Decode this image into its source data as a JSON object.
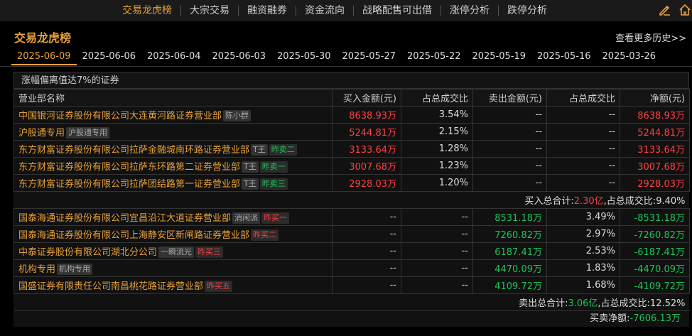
{
  "nav": {
    "items": [
      "交易龙虎榜",
      "大宗交易",
      "融资融券",
      "资金流向",
      "战略配售可出借",
      "涨停分析",
      "跌停分析"
    ],
    "active": 0
  },
  "icons": [
    "edit-icon",
    "home-icon"
  ],
  "header": {
    "title": "交易龙虎榜",
    "more": "查看更多历史>>"
  },
  "dates": [
    "2025-06-09",
    "2025-06-06",
    "2025-06-04",
    "2025-06-03",
    "2025-05-30",
    "2025-05-27",
    "2025-05-22",
    "2025-05-19",
    "2025-05-16",
    "2025-03-26"
  ],
  "active_date": 0,
  "section": {
    "caption": "涨幅偏离值达7%的证券"
  },
  "columns": [
    "营业部名称",
    "买入金额(元)",
    "占总成交比",
    "卖出金额(元)",
    "占总成交比",
    "净额(元)"
  ],
  "buy_rows": [
    {
      "name": "中国银河证券股份有限公司大连黄河路证券营业部",
      "tag": "陈小群",
      "tag2": "",
      "buy": "8638.93万",
      "buy_pct": "3.54%",
      "sell": "--",
      "sell_pct": "--",
      "net": "8638.93万"
    },
    {
      "name": "沪股通专用",
      "tag": "沪股通专用",
      "tag2": "",
      "buy": "5244.81万",
      "buy_pct": "2.15%",
      "sell": "--",
      "sell_pct": "--",
      "net": "5244.81万"
    },
    {
      "name": "东方财富证券股份有限公司拉萨金融城南环路证券营业部",
      "tag": "T王",
      "tag2": "昨卖二",
      "buy": "3133.64万",
      "buy_pct": "1.28%",
      "sell": "--",
      "sell_pct": "--",
      "net": "3133.64万"
    },
    {
      "name": "东方财富证券股份有限公司拉萨东环路第二证券营业部",
      "tag": "T王",
      "tag2": "昨卖一",
      "buy": "3007.68万",
      "buy_pct": "1.23%",
      "sell": "--",
      "sell_pct": "--",
      "net": "3007.68万"
    },
    {
      "name": "东方财富证券股份有限公司拉萨团结路第一证券营业部",
      "tag": "T王",
      "tag2": "昨卖三",
      "buy": "2928.03万",
      "buy_pct": "1.20%",
      "sell": "--",
      "sell_pct": "--",
      "net": "2928.03万"
    }
  ],
  "buy_summary": {
    "label": "买入总合计:",
    "total": "2.30亿",
    "pct_label": ",占总成交比:",
    "pct": "9.40%"
  },
  "sell_rows": [
    {
      "name": "国泰海通证券股份有限公司宜昌沿江大道证券营业部",
      "tag": "消闲派",
      "tag2": "昨买一",
      "buy": "--",
      "buy_pct": "--",
      "sell": "8531.18万",
      "sell_pct": "3.49%",
      "net": "-8531.18万"
    },
    {
      "name": "国泰海通证券股份有限公司上海静安区新闸路证券营业部",
      "tag": "",
      "tag2": "昨买二",
      "buy": "--",
      "buy_pct": "--",
      "sell": "7260.82万",
      "sell_pct": "2.97%",
      "net": "-7260.82万"
    },
    {
      "name": "中泰证券股份有限公司湖北分公司",
      "tag": "一瞬流光",
      "tag2": "昨买三",
      "buy": "--",
      "buy_pct": "--",
      "sell": "6187.41万",
      "sell_pct": "2.53%",
      "net": "-6187.41万"
    },
    {
      "name": "机构专用",
      "tag": "机构专用",
      "tag2": "",
      "buy": "--",
      "buy_pct": "--",
      "sell": "4470.09万",
      "sell_pct": "1.83%",
      "net": "-4470.09万"
    },
    {
      "name": "国盛证券有限责任公司南昌桃花路证券营业部",
      "tag": "",
      "tag2": "昨买五",
      "buy": "--",
      "buy_pct": "--",
      "sell": "4109.72万",
      "sell_pct": "1.68%",
      "net": "-4109.72万"
    }
  ],
  "sell_summary": {
    "label": "卖出总合计:",
    "total": "3.06亿",
    "pct_label": ",占总成交比:",
    "pct": "12.52%"
  },
  "net_summary": {
    "label": "买卖净额:",
    "value": "-7606.13万"
  },
  "colors": {
    "accent": "#e8a13a",
    "up": "#ff4040",
    "down": "#1fc259",
    "bg": "#000000"
  }
}
